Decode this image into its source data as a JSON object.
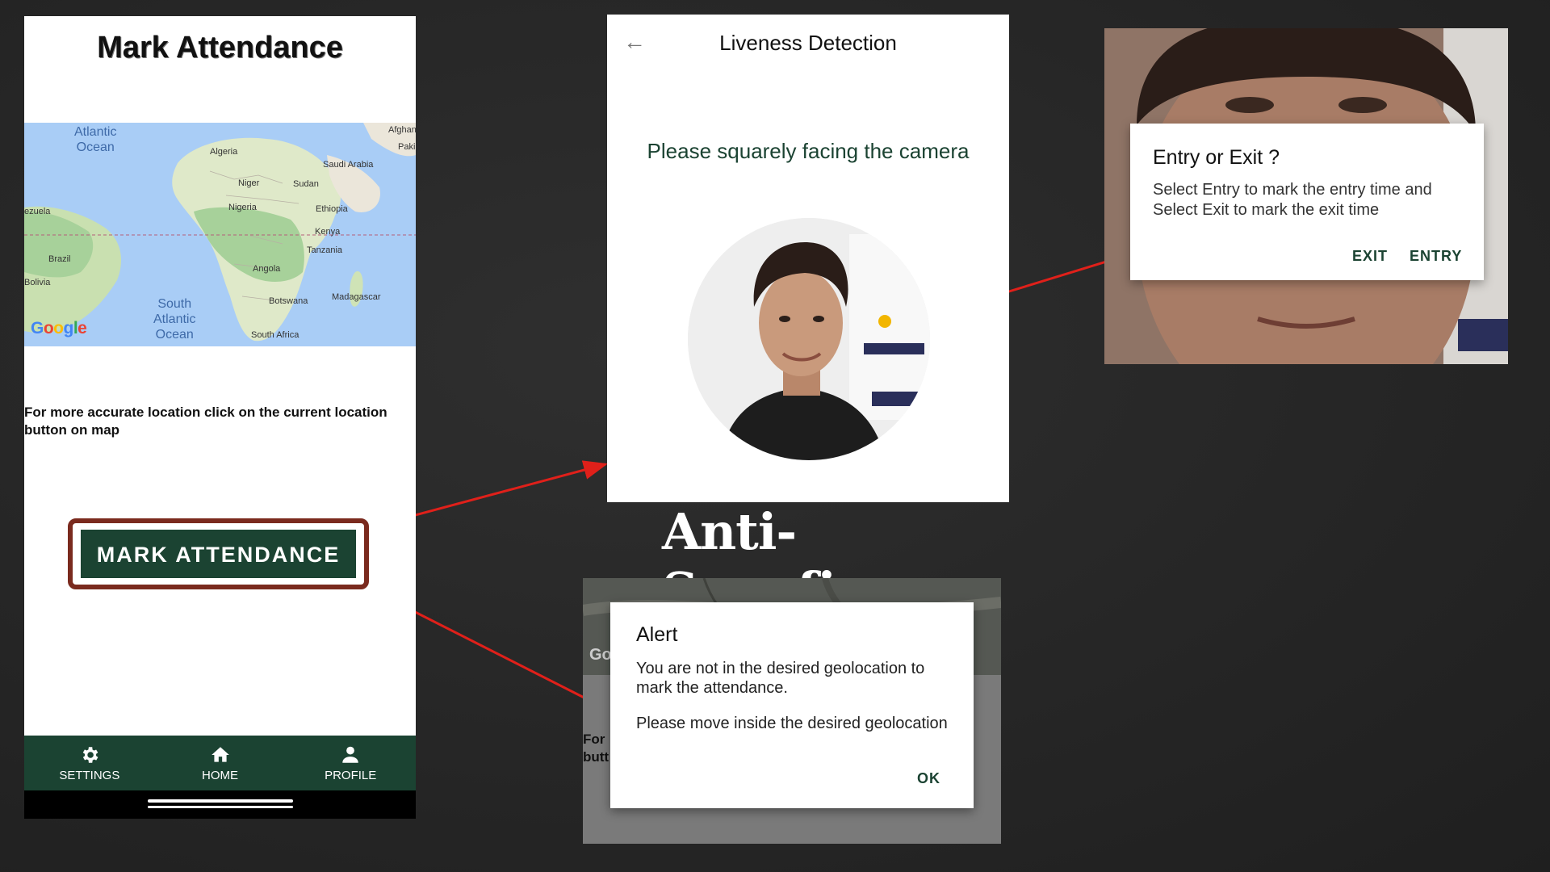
{
  "mark_screen": {
    "title": "Mark Attendance",
    "map": {
      "labels": {
        "atlantic_ocean": "Atlantic\nOcean",
        "south_atlantic_ocean": "South\nAtlantic\nOcean",
        "algeria": "Algeria",
        "saudi_arabia": "Saudi Arabia",
        "niger": "Niger",
        "sudan": "Sudan",
        "nigeria": "Nigeria",
        "ethiopia": "Ethiopia",
        "kenya": "Kenya",
        "tanzania": "Tanzania",
        "angola": "Angola",
        "madagascar": "Madagascar",
        "botswana": "Botswana",
        "south_africa": "South Africa",
        "brazil": "Brazil",
        "bolivia": "Bolivia",
        "venezuela": "ezuela",
        "afghanistan": "Afghan",
        "pakistan": "Paki"
      },
      "provider_logo": "Google"
    },
    "hint": "For more accurate location click on the current location button on map",
    "mark_button": "MARK ATTENDANCE",
    "nav": {
      "settings": "SETTINGS",
      "home": "HOME",
      "profile": "PROFILE"
    }
  },
  "liveness_screen": {
    "title": "Liveness Detection",
    "instruction": "Please squarely facing the camera"
  },
  "caption": "Anti-Spoofing",
  "alert_dialog": {
    "title": "Alert",
    "message_line1": "You are not in the desired geolocation to mark the attendance.",
    "message_line2": "Please move inside the desired geolocation",
    "ok_button": "OK",
    "behind_text_1": "For",
    "behind_text_2": "butt",
    "behind_logo": "Go"
  },
  "entry_dialog": {
    "title": "Entry or Exit ?",
    "message": "Select Entry to mark the entry time and Select Exit to mark the exit time",
    "exit_button": "EXIT",
    "entry_button": "ENTRY"
  },
  "colors": {
    "brand_green": "#1b4332",
    "highlight_border": "#7a2a1e",
    "arrow_red": "#e0201a",
    "map_water": "#a9cdf6",
    "map_land": "#e9e6df"
  }
}
